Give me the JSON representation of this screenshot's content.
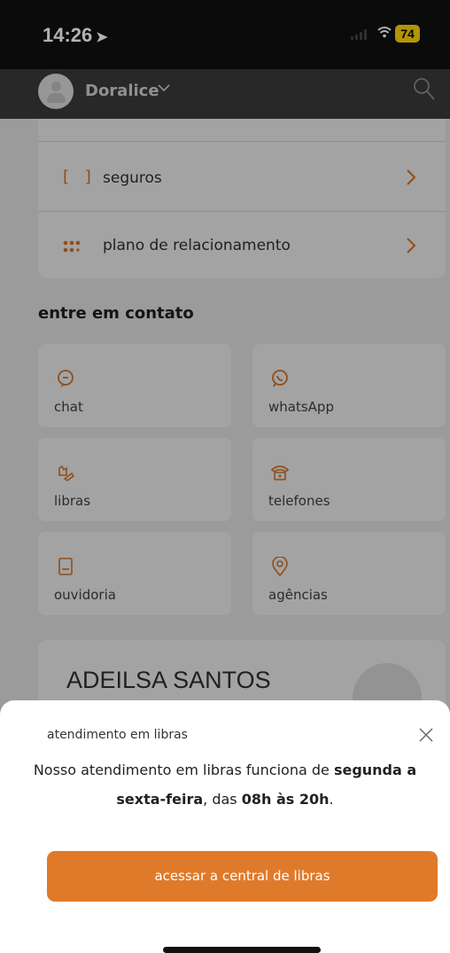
{
  "status_bar": {
    "time": "14:26",
    "battery": "74"
  },
  "header": {
    "user_name": "Doralice"
  },
  "menu": [
    {
      "label": "seguros",
      "icon": "brackets-icon"
    },
    {
      "label": "plano de relacionamento",
      "icon": "dots-grid-icon"
    }
  ],
  "contact": {
    "title": "entre em contato",
    "tiles": [
      {
        "label": "chat",
        "icon": "chat-icon"
      },
      {
        "label": "whatsApp",
        "icon": "whatsapp-icon"
      },
      {
        "label": "libras",
        "icon": "hands-icon"
      },
      {
        "label": "telefones",
        "icon": "telephone-icon"
      },
      {
        "label": "ouvidoria",
        "icon": "document-icon"
      },
      {
        "label": "agências",
        "icon": "location-pin-icon"
      }
    ]
  },
  "profile": {
    "name": "ADEILSA SANTOS"
  },
  "sheet": {
    "title": "atendimento em libras",
    "message_pre": "Nosso atendimento em libras funciona de ",
    "message_days": "segunda a sexta-feira",
    "message_mid": ", das ",
    "message_hours": "08h às 20h",
    "message_end": ".",
    "button": "acessar a central de libras"
  },
  "colors": {
    "accent": "#e07a2b",
    "header_bg": "#3a3a3a",
    "battery": "#ffd60a"
  }
}
